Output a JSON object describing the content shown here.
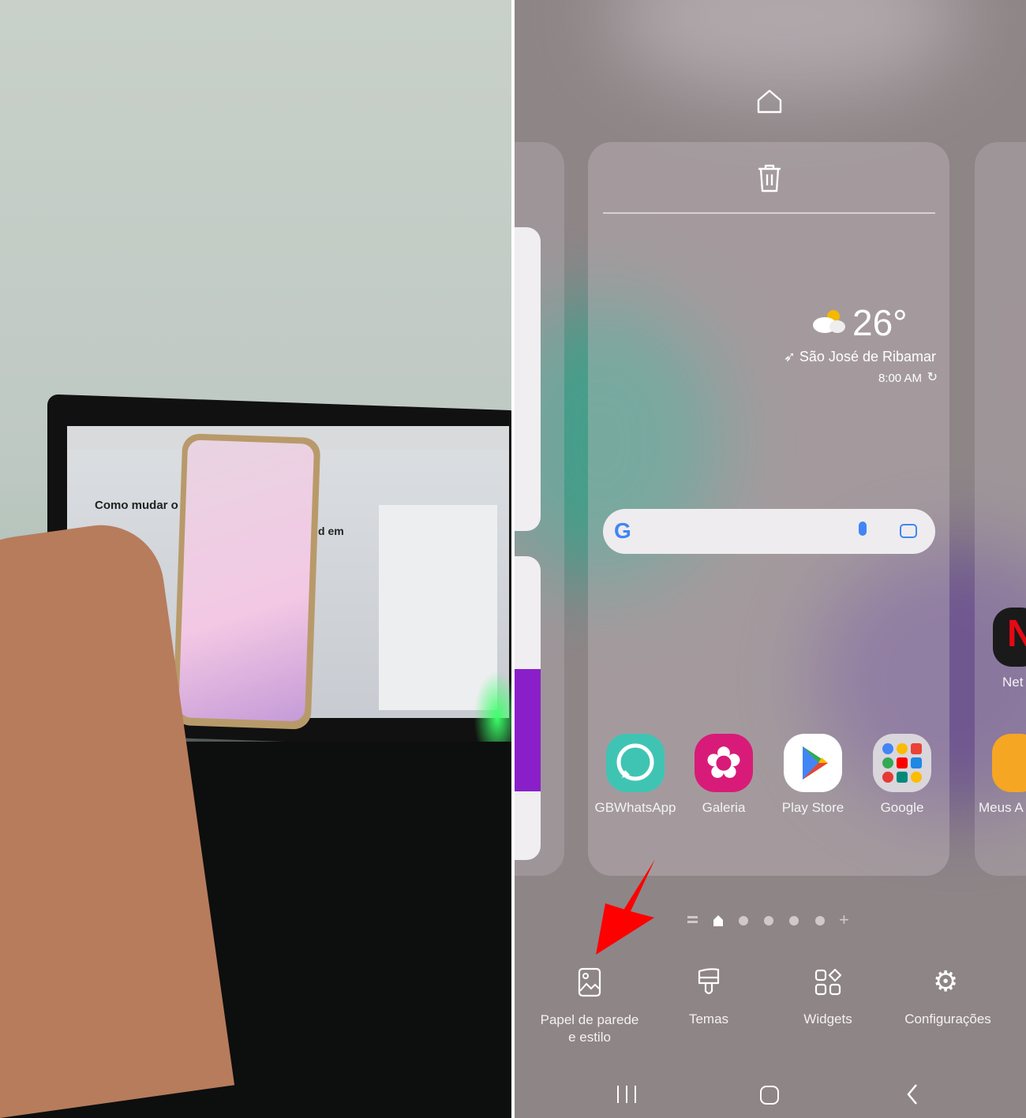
{
  "photo": {
    "laptop_screen_heading": "Como mudar o p",
    "laptop_screen_text_partial": "d em"
  },
  "home_edit": {
    "weather": {
      "temperature": "26°",
      "location": "São José de Ribamar",
      "time": "8:00 AM"
    },
    "apps": [
      {
        "label": "GBWhatsApp",
        "color": "#3fc4b4"
      },
      {
        "label": "Galeria",
        "color": "#d81b78"
      },
      {
        "label": "Play Store",
        "color": "#ffffff"
      },
      {
        "label": "Google",
        "color": "#d9d6dc"
      }
    ],
    "side_apps": {
      "right_top_partial": "Net",
      "right_bottom_partial": "Meus A"
    },
    "page_indicator": {
      "pages": 5,
      "current": "home"
    },
    "options": [
      {
        "label": "Papel de parede\ne estilo",
        "icon": "wallpaper-icon"
      },
      {
        "label": "Temas",
        "icon": "brush-icon"
      },
      {
        "label": "Widgets",
        "icon": "widgets-icon"
      },
      {
        "label": "Configurações",
        "icon": "gear-icon"
      }
    ],
    "annotation_color": "#ff0000"
  }
}
